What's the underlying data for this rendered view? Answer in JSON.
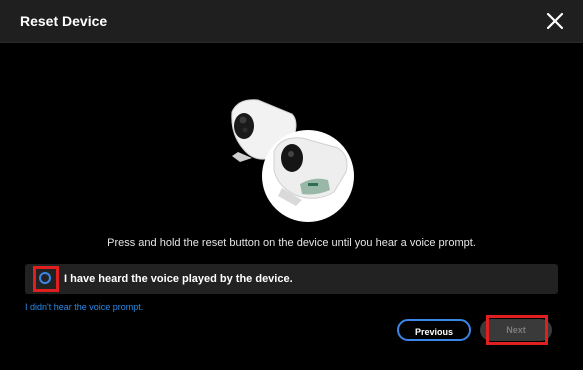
{
  "dialog": {
    "title": "Reset Device",
    "close_icon": "close-icon"
  },
  "illustration": {
    "icon": "camera-reset-illustration"
  },
  "instruction": "Press and hold the reset button on the device until you hear a voice prompt.",
  "confirm": {
    "label": "I have heard the voice played by the device.",
    "checked": false
  },
  "help_link": "I didn't hear the voice prompt.",
  "buttons": {
    "previous": "Previous",
    "next": "Next",
    "next_enabled": false
  },
  "colors": {
    "accent": "#3a86e6",
    "highlight": "#e02020",
    "link": "#2b8be8"
  }
}
